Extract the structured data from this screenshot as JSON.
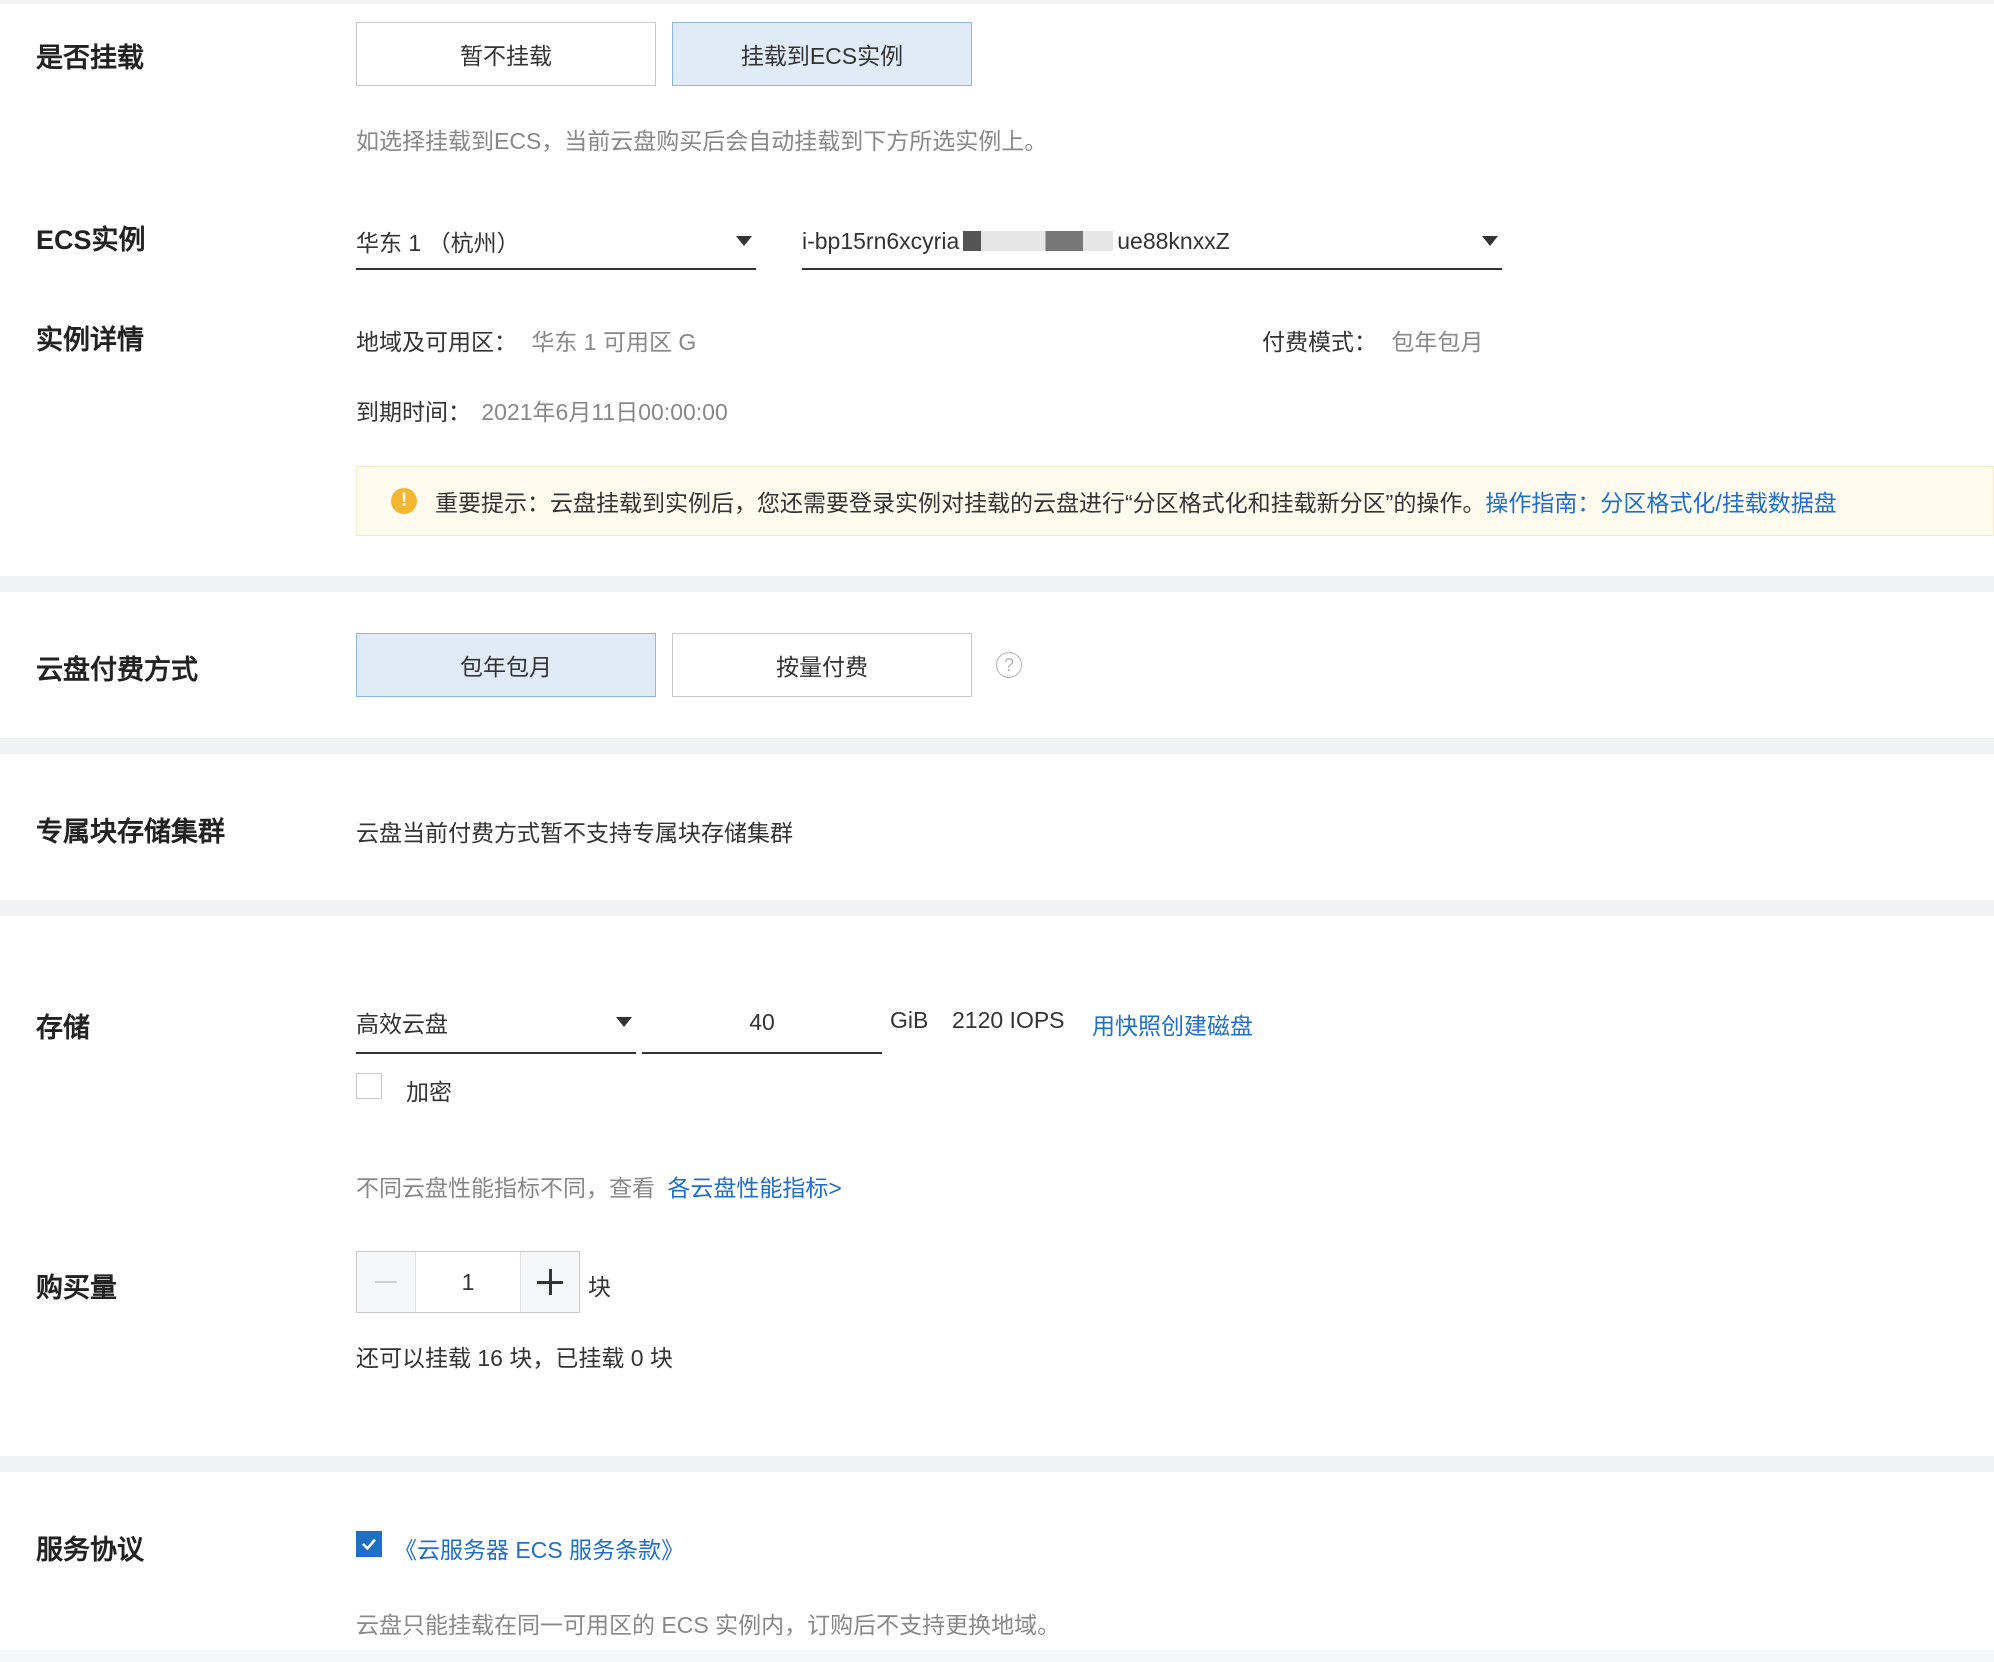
{
  "mount": {
    "label": "是否挂载",
    "options": [
      "暂不挂载",
      "挂载到ECS实例"
    ],
    "selected": "挂载到ECS实例",
    "hint": "如选择挂载到ECS，当前云盘购买后会自动挂载到下方所选实例上。"
  },
  "ecs": {
    "label": "ECS实例",
    "region_value": "华东 1 （杭州）",
    "instance_prefix": "i-bp15rn6xcyria",
    "instance_suffix": "ue88knxxZ"
  },
  "detail": {
    "label": "实例详情",
    "region_key": "地域及可用区：",
    "region_value": "华东 1 可用区 G",
    "pay_key": "付费模式：",
    "pay_value": "包年包月",
    "expire_key": "到期时间：",
    "expire_value": "2021年6月11日00:00:00",
    "notice_text": "重要提示：云盘挂载到实例后，您还需要登录实例对挂载的云盘进行“分区格式化和挂载新分区”的操作。",
    "notice_link": "操作指南：分区格式化/挂载数据盘"
  },
  "billing": {
    "label": "云盘付费方式",
    "options": [
      "包年包月",
      "按量付费"
    ],
    "selected": "包年包月",
    "help_icon": "question-circle-icon"
  },
  "cluster": {
    "label": "专属块存储集群",
    "value": "云盘当前付费方式暂不支持专属块存储集群"
  },
  "storage": {
    "label": "存储",
    "type_value": "高效云盘",
    "size_value": "40",
    "unit": "GiB",
    "iops": "2120 IOPS",
    "snapshot_link": "用快照创建磁盘",
    "encrypt_label": "加密",
    "perf_hint": "不同云盘性能指标不同，查看",
    "perf_link": "各云盘性能指标>"
  },
  "quantity": {
    "label": "购买量",
    "value": "1",
    "unit": "块",
    "hint": "还可以挂载 16 块，已挂载 0 块"
  },
  "agreement": {
    "label": "服务协议",
    "link": "《云服务器 ECS 服务条款》",
    "checked": true,
    "hint": "云盘只能挂载在同一可用区的 ECS 实例内，订购后不支持更换地域。"
  }
}
